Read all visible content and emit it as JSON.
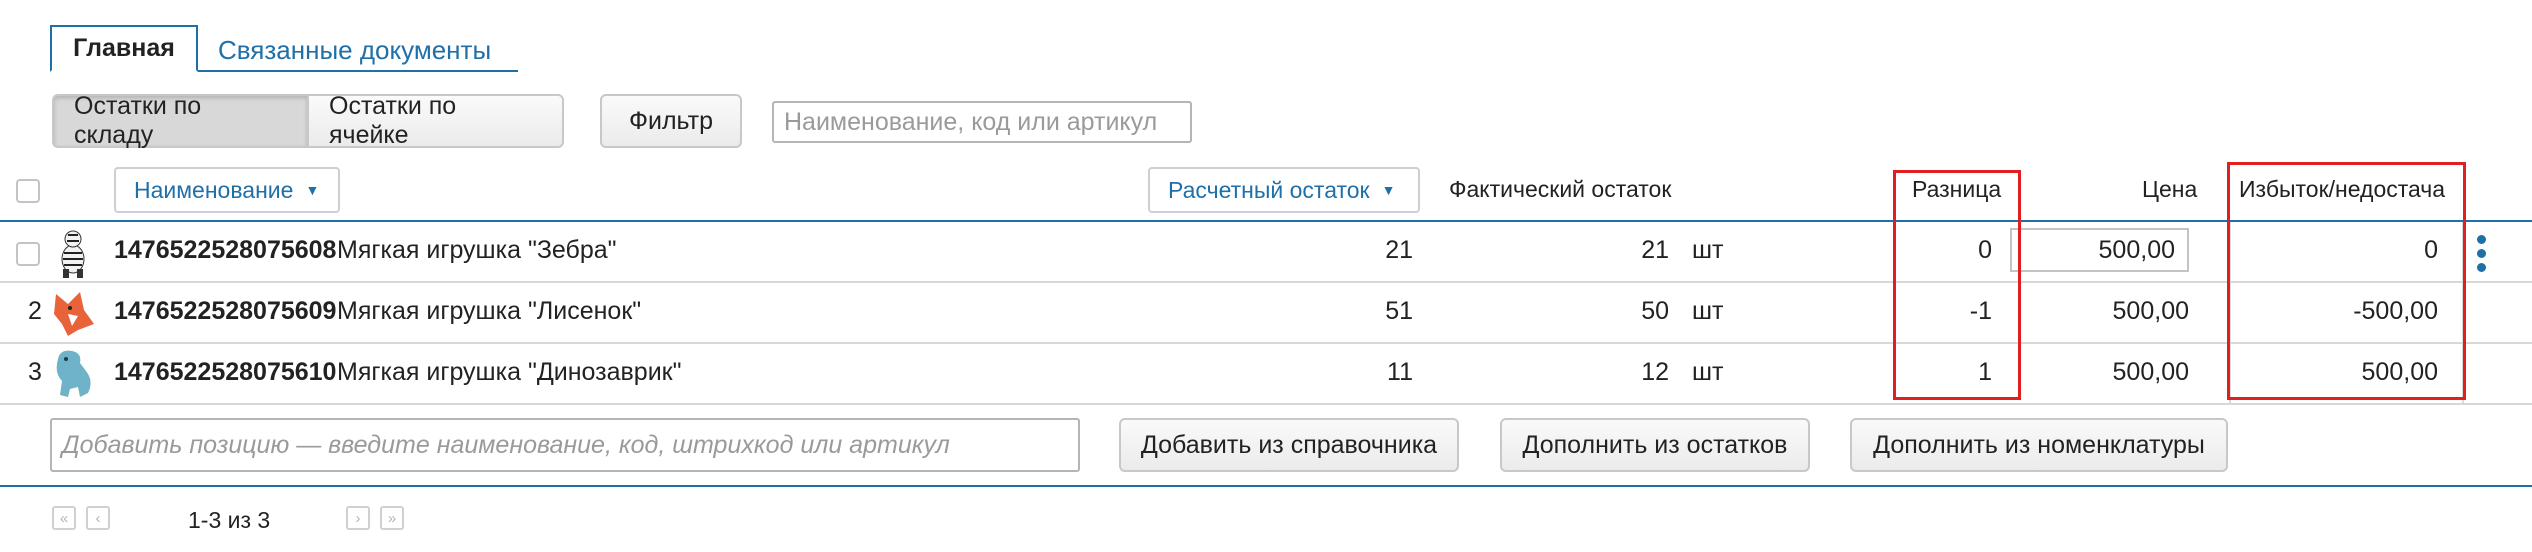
{
  "tabs": [
    {
      "label": "Главная",
      "active": true
    },
    {
      "label": "Связанные документы",
      "active": false
    }
  ],
  "toolbar": {
    "view_buttons": [
      "Остатки по складу",
      "Остатки по ячейке"
    ],
    "filter_label": "Фильтр",
    "search_placeholder": "Наименование, код или артикул"
  },
  "table": {
    "headers": {
      "name": "Наименование",
      "calc_stock": "Расчетный остаток",
      "actual_stock": "Фактический остаток",
      "difference": "Разница",
      "price": "Цена",
      "surplus": "Избыток/недостача"
    },
    "rows": [
      {
        "num": "",
        "code": "1476522528075608",
        "name": "Мягкая игрушка \"Зебра\"",
        "name_is_link": true,
        "calc": "21",
        "actual": "21",
        "unit": "шт",
        "diff": "0",
        "price": "500,00",
        "surplus": "0",
        "icon": "zebra-toy-icon"
      },
      {
        "num": "2",
        "code": "1476522528075609",
        "name": "Мягкая игрушка \"Лисенок\"",
        "name_is_link": false,
        "calc": "51",
        "actual": "50",
        "unit": "шт",
        "diff": "-1",
        "price": "500,00",
        "surplus": "-500,00",
        "icon": "fox-toy-icon"
      },
      {
        "num": "3",
        "code": "1476522528075610",
        "name": "Мягкая игрушка \"Динозаврик\"",
        "name_is_link": false,
        "calc": "11",
        "actual": "12",
        "unit": "шт",
        "diff": "1",
        "price": "500,00",
        "surplus": "500,00",
        "icon": "dino-toy-icon"
      }
    ]
  },
  "add_row": {
    "placeholder": "Добавить позицию — введите наименование, код, штрихкод или артикул",
    "buttons": [
      "Добавить из справочника",
      "Дополнить из остатков",
      "Дополнить из номенклатуры"
    ]
  },
  "pager": {
    "text": "1-3 из 3"
  },
  "colors": {
    "accent": "#1f6fa8",
    "highlight": "#e02020"
  }
}
